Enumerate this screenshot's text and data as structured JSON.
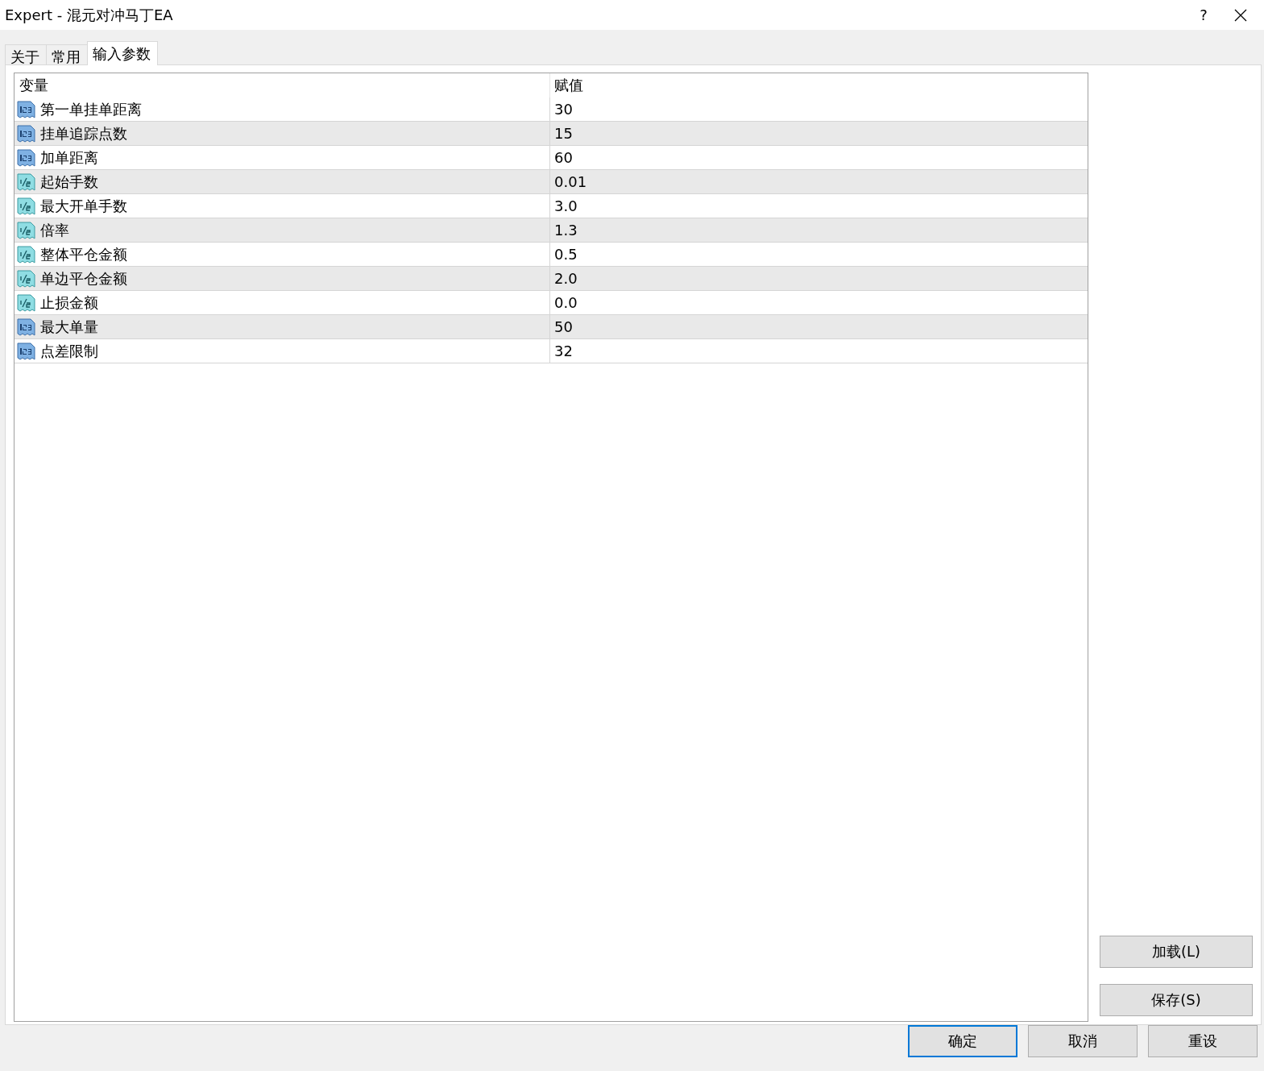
{
  "window": {
    "title": "Expert - 混元对冲马丁EA",
    "help": "?"
  },
  "tabs": [
    {
      "label": "关于",
      "selected": false
    },
    {
      "label": "常用",
      "selected": false
    },
    {
      "label": "输入参数",
      "selected": true
    }
  ],
  "table": {
    "columns": [
      "变量",
      "赋值"
    ],
    "rows": [
      {
        "kind": "int",
        "name": "第一单挂单距离",
        "value": "30"
      },
      {
        "kind": "int",
        "name": "挂单追踪点数",
        "value": "15"
      },
      {
        "kind": "int",
        "name": "加单距离",
        "value": "60"
      },
      {
        "kind": "double",
        "name": "起始手数",
        "value": "0.01"
      },
      {
        "kind": "double",
        "name": "最大开单手数",
        "value": "3.0"
      },
      {
        "kind": "double",
        "name": "倍率",
        "value": "1.3"
      },
      {
        "kind": "double",
        "name": "整体平仓金额",
        "value": "0.5"
      },
      {
        "kind": "double",
        "name": "单边平仓金额",
        "value": "2.0"
      },
      {
        "kind": "double",
        "name": "止损金额",
        "value": "0.0"
      },
      {
        "kind": "int",
        "name": "最大单量",
        "value": "50"
      },
      {
        "kind": "int",
        "name": "点差限制",
        "value": "32"
      }
    ]
  },
  "side_buttons": [
    "加载(L)",
    "保存(S)"
  ],
  "footer_buttons": [
    {
      "label": "确定",
      "focused": true
    },
    {
      "label": "取消",
      "focused": false
    },
    {
      "label": "重设",
      "focused": false
    }
  ]
}
